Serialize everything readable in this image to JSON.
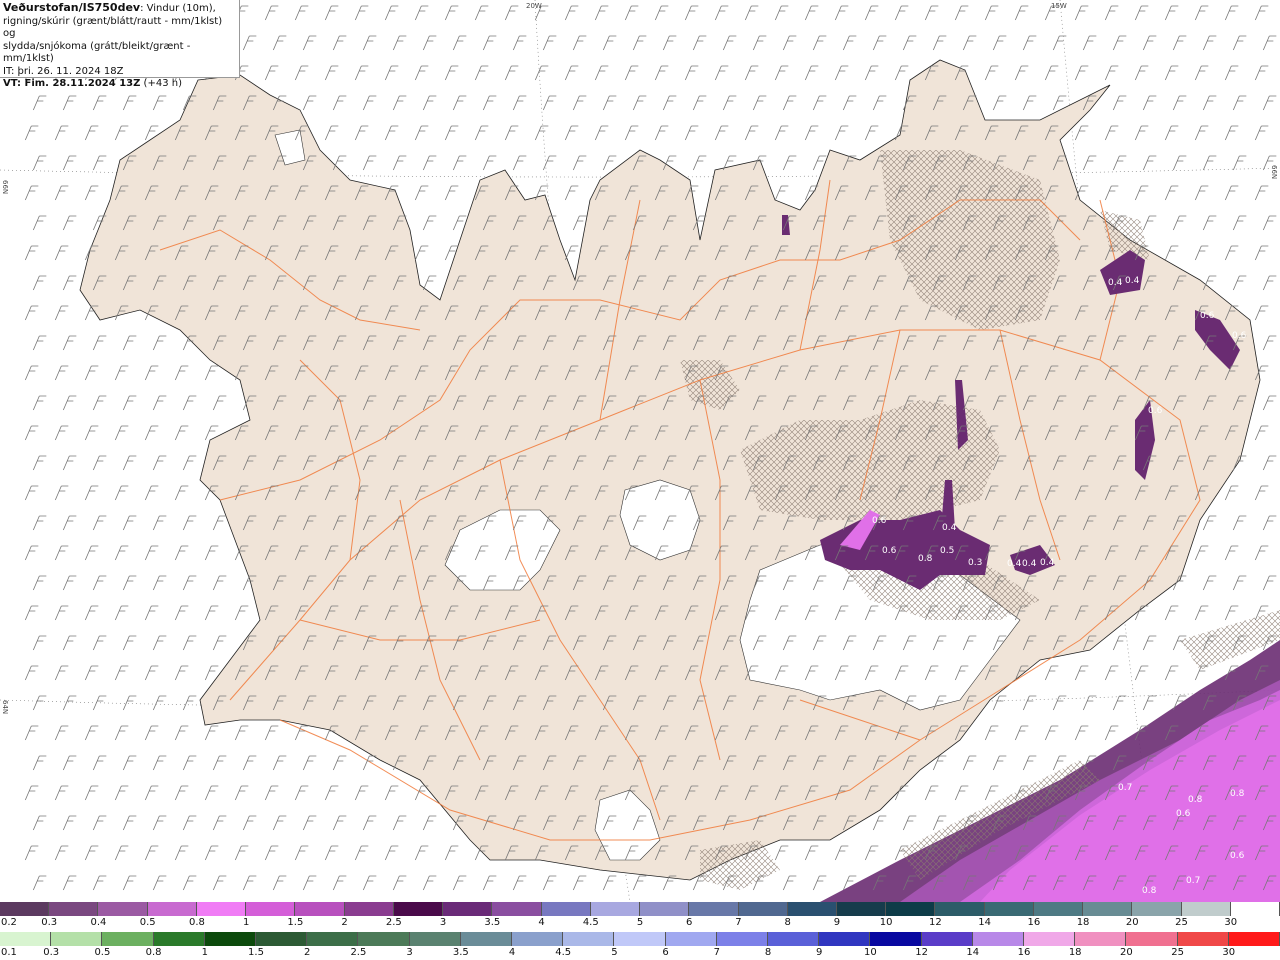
{
  "header": {
    "title": "Veðurstofan/IS750dev",
    "title_suffix": ": Vindur (10m),",
    "line2": "rigning/skúrir (grænt/blátt/rautt - mm/1klst) og",
    "line3": "slydda/snjókoma (grátt/bleikt/grænt - mm/1klst)",
    "init_time": "IT: þri. 26. 11. 2024 18Z",
    "valid_prefix": "VT: Fim. 28.11.2024 13Z",
    "valid_suffix": " (+43 h)"
  },
  "grid_labels": {
    "lon_20w": "20W",
    "lon_15w": "15W",
    "lat_66n_left": "66N",
    "lat_66n_right": "66N",
    "lat_64n_left": "64N"
  },
  "snow_scale": {
    "labels": [
      "0.2",
      "0.3",
      "0.4",
      "0.5",
      "0.8",
      "1",
      "1.5",
      "2",
      "2.5",
      "3",
      "3.5",
      "4",
      "4.5",
      "5",
      "6",
      "7",
      "8",
      "9",
      "10",
      "12",
      "14",
      "16",
      "18",
      "20",
      "25",
      "30"
    ],
    "colors": [
      "#5c3a60",
      "#7a4880",
      "#9b5aa3",
      "#c86ad0",
      "#f07cf5",
      "#d45ed8",
      "#b850be",
      "#8a3c90",
      "#4a0a4a",
      "#6a2a78",
      "#8a4ea0",
      "#7878c0",
      "#a8a8e0",
      "#9090c8",
      "#6878a8",
      "#506890",
      "#2a5070",
      "#163c4c",
      "#0e3c48",
      "#2c5c68",
      "#3a6a74",
      "#4e7a84",
      "#688c94",
      "#8aa4aa",
      "#c0cccc",
      "#ffffff"
    ]
  },
  "rain_scale": {
    "labels": [
      "0.1",
      "0.3",
      "0.5",
      "0.8",
      "1",
      "1.5",
      "2",
      "2.5",
      "3",
      "3.5",
      "4",
      "4.5",
      "5",
      "6",
      "7",
      "8",
      "9",
      "10",
      "12",
      "14",
      "16",
      "18",
      "20",
      "25",
      "30"
    ],
    "colors": [
      "#d8f4d0",
      "#b4e0a8",
      "#6cb060",
      "#2a7a2a",
      "#0c4a0c",
      "#2c5a34",
      "#3c6e48",
      "#4c7a58",
      "#5a8270",
      "#6a8c98",
      "#8aa0cc",
      "#aab8e8",
      "#c0c8f8",
      "#a0a8f0",
      "#7c80e8",
      "#5a60d8",
      "#3036c0",
      "#0808a0",
      "#5a3cc8",
      "#b888e8",
      "#f0a8e8",
      "#f090c0",
      "#f07090",
      "#f04848",
      "#ff1a1a"
    ]
  },
  "precip_labels": [
    "0.6",
    "0.6",
    "0.4",
    "0.5",
    "0.8",
    "0.3",
    "0.4",
    "0.4",
    "0.4",
    "0.4",
    "0.4",
    "0.6",
    "0.6",
    "0.6",
    "0.7",
    "0.8",
    "0.6",
    "0.8",
    "0.6",
    "0.7",
    "0.8"
  ],
  "colors": {
    "land": "#f0e4d8",
    "roads": "#f07a3a",
    "sea": "#ffffff",
    "glacier": "#ffffff",
    "precip_dark": "#6a2c72",
    "precip_light": "#e070e8",
    "wind_barb": "#777777"
  }
}
